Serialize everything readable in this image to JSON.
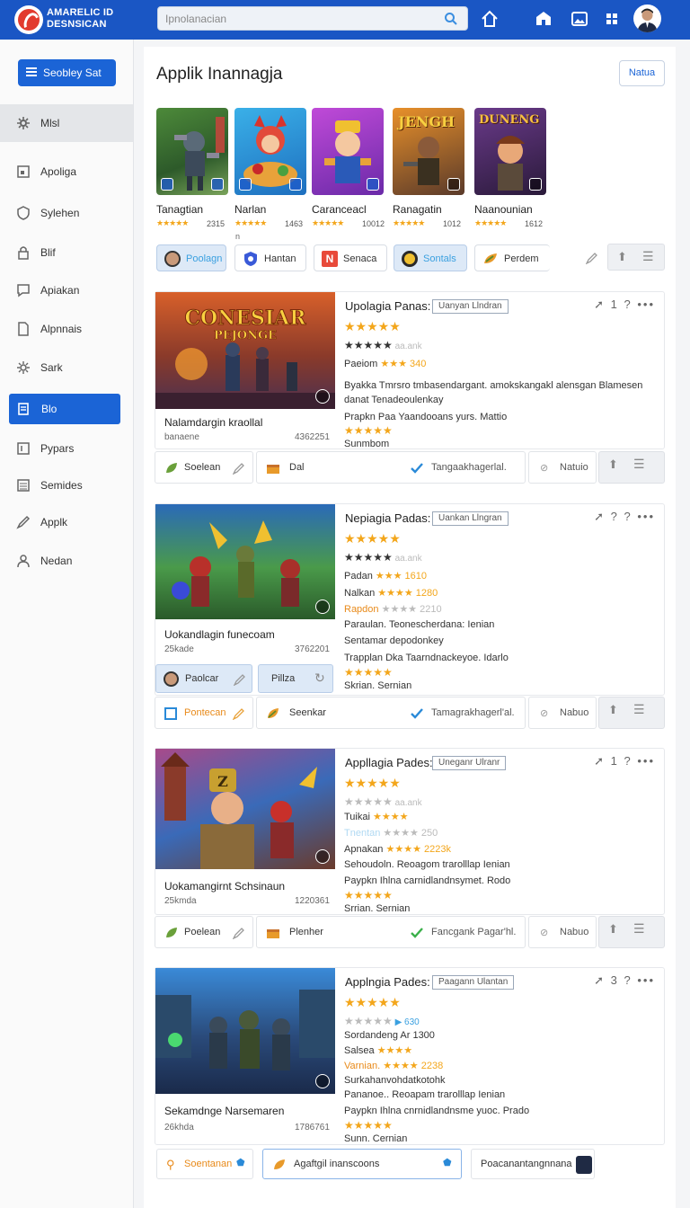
{
  "app": {
    "brand_line1": "AMARELIC ID",
    "brand_line2": "DESNSICAN",
    "search_placeholder": "Ipnolanacian"
  },
  "sidebar": {
    "button_label": "Seobley Sat",
    "items": [
      {
        "label": "Mlsl",
        "icon": "gear-icon"
      },
      {
        "label": "Apoliga",
        "icon": "square-icon"
      },
      {
        "label": "Sylehen",
        "icon": "shield-icon"
      },
      {
        "label": "Blif",
        "icon": "lock-icon"
      },
      {
        "label": "Apiakan",
        "icon": "chat-icon"
      },
      {
        "label": "Alpnnais",
        "icon": "document-icon"
      },
      {
        "label": "Sark",
        "icon": "gear-icon"
      },
      {
        "label": "Blo",
        "icon": "bookmark-icon"
      },
      {
        "label": "Pypars",
        "icon": "square-icon"
      },
      {
        "label": "Semides",
        "icon": "list-icon"
      },
      {
        "label": "Applk",
        "icon": "pen-icon"
      },
      {
        "label": "Nedan",
        "icon": "user-icon"
      }
    ]
  },
  "main": {
    "title": "Applik Inannagja",
    "top_button": "Natua",
    "small_n": "n",
    "featured": [
      {
        "name": "Tanagtian",
        "stars": "★★★★★",
        "count": "2315"
      },
      {
        "name": "Narlan",
        "stars": "★★★★★",
        "count": "1463"
      },
      {
        "name": "Caranceacl",
        "stars": "★★★★★",
        "count": "10012"
      },
      {
        "name": "Ranagatin",
        "stars": "★★★★★",
        "count": "1012"
      },
      {
        "name": "Naanounian",
        "stars": "★★★★★",
        "count": "1612"
      }
    ],
    "feat_titles": {
      "f4": "JENGH",
      "f5": "DUNENG"
    },
    "chips": [
      {
        "label": "Poolagn"
      },
      {
        "label": "Hantan"
      },
      {
        "label": "Senaca"
      },
      {
        "label": "Sontals"
      },
      {
        "label": "Perdem"
      }
    ]
  },
  "cards": [
    {
      "title": "Nalamdargin kraollal",
      "sub": "banaene",
      "num": "4362251",
      "art_text1": "CONESIAR",
      "art_text2": "PEJONGE",
      "head": "Upolagia Panas:",
      "tag": "Uanyan Llndran",
      "acts": "➚ 1 ? •••",
      "lines": [
        {
          "pre": "★★★★★",
          "text": "",
          "cls": "gold"
        },
        {
          "pre": "★★★★★",
          "text": "  aa.ank",
          "cls": "blue"
        },
        {
          "pre": "Paeiom ",
          "text": "★★★ 340",
          "cls": ""
        },
        {
          "pre": "",
          "text": "Byakka Tmrsro tmbasendargant. amokskangakl alensgan Blamesen",
          "cls": ""
        },
        {
          "pre": "",
          "text": "danat Tenadeoulenkay",
          "cls": ""
        },
        {
          "pre": "",
          "text": "Prapkn Paa Yaandooans yurs. Mattio",
          "cls": ""
        },
        {
          "pre": "★★★★★",
          "text": "",
          "cls": "gold"
        },
        {
          "pre": "Sunmbom",
          "text": "",
          "cls": "orange small"
        }
      ]
    },
    {
      "title": "Uokandlagin funecoam",
      "sub": "25kade",
      "num": "3762201",
      "head": "Nepiagia Padas:",
      "tag": "Uankan Llngran",
      "acts": "➚ ? ? •••",
      "lines": [
        {
          "pre": "★★★★★",
          "text": "",
          "cls": "gold"
        },
        {
          "pre": "★★★★★",
          "text": "  aa.ank",
          "cls": "blue"
        },
        {
          "pre": "Padan ",
          "text": "★★★ 1610",
          "cls": ""
        },
        {
          "pre": "Nalkan ",
          "text": "★★★★ 1280",
          "cls": ""
        },
        {
          "pre": "Rapdon ",
          "text": "★★★★ 2210",
          "cls": ""
        },
        {
          "pre": "",
          "text": "Paraulan.  Teonescherdana: Ienian",
          "cls": ""
        },
        {
          "pre": "",
          "text": "Sentamar depodonkey",
          "cls": ""
        },
        {
          "pre": "",
          "text": "Trapplan Dka Taarndnackeyoe. Idarlo",
          "cls": ""
        },
        {
          "pre": "★★★★★",
          "text": "",
          "cls": "gold"
        },
        {
          "pre": "Skrian. Sernian",
          "text": "",
          "cls": "orange small"
        }
      ]
    },
    {
      "title": "Uokamangirnt Schsinaun",
      "sub": "25kmda",
      "num": "1220361",
      "head": "Appllagia Pades:",
      "tag": "Uneganr Ulranr",
      "acts": "➚ 1 ? •••",
      "lines": [
        {
          "pre": "★★★★★",
          "text": "",
          "cls": "gold"
        },
        {
          "pre": "★★★★★",
          "text": "  aa.ank",
          "cls": "grey"
        },
        {
          "pre": "Tuikai ",
          "text": "★★★★",
          "cls": ""
        },
        {
          "pre": "Tnentan ",
          "text": "★★★★ 250",
          "cls": ""
        },
        {
          "pre": "Apnakan ",
          "text": "★★★★ 2223k",
          "cls": ""
        },
        {
          "pre": "",
          "text": "Sehoudoln.  Reoagom trarolllap Ienian",
          "cls": ""
        },
        {
          "pre": "",
          "text": "Paypkn Ihlna carnidlandnsymet. Rodo",
          "cls": ""
        },
        {
          "pre": "★★★★★",
          "text": "",
          "cls": "gold"
        },
        {
          "pre": "Srrian. Sernian",
          "text": "",
          "cls": "orange small"
        }
      ]
    },
    {
      "title": "Sekamdnge Narsemaren",
      "sub": "26khda",
      "num": "1786761",
      "head": "Applngia Pades:",
      "tag": "Paagann Ulantan",
      "acts": "➚ 3 ? •••",
      "lines": [
        {
          "pre": "★★★★★",
          "text": "",
          "cls": "gold"
        },
        {
          "pre": "★★★★★",
          "text": "  ▶ 630",
          "cls": "grey"
        },
        {
          "pre": "Sordandeng ",
          "text": "Ar 1300",
          "cls": ""
        },
        {
          "pre": "Salsea ",
          "text": "★★★★",
          "cls": ""
        },
        {
          "pre": "Varnian. ",
          "text": "★★★★ 2238",
          "cls": ""
        },
        {
          "pre": "",
          "text": "Surkahanvohdatkotohk",
          "cls": ""
        },
        {
          "pre": "",
          "text": "Pananoe..  Reoapam trarolllap Ienian",
          "cls": ""
        },
        {
          "pre": "",
          "text": "Paypkn Ihlna cnrnidlandnsme yuoc. Prado",
          "cls": ""
        },
        {
          "pre": "★★★★★",
          "text": "",
          "cls": "gold"
        },
        {
          "pre": "Sunn. Cernian",
          "text": "",
          "cls": "orange small"
        }
      ]
    }
  ],
  "bars": {
    "b1": {
      "left": "Soelean",
      "mid": "Dal",
      "right": "Tangaakhagerlal.",
      "end": "Natuio"
    },
    "b2a": {
      "left": "Paolcar",
      "mid": "Pillza"
    },
    "b2": {
      "left": "Pontecan",
      "mid": "Seenkar",
      "right": "Tamagrakhagerl'al.",
      "end": "Nabuo"
    },
    "b3": {
      "left": "Poelean",
      "mid": "Plenher",
      "right": "Fancgank Pagar'hl.",
      "end": "Nabuo"
    },
    "b4": {
      "left": "Soentanan",
      "mid": "Agaftgil inanscoons",
      "right": "Poacanantangnnana"
    }
  },
  "colors": {
    "accent": "#1b64d6",
    "topbar": "#1a56c4",
    "star": "#f3a61b"
  }
}
